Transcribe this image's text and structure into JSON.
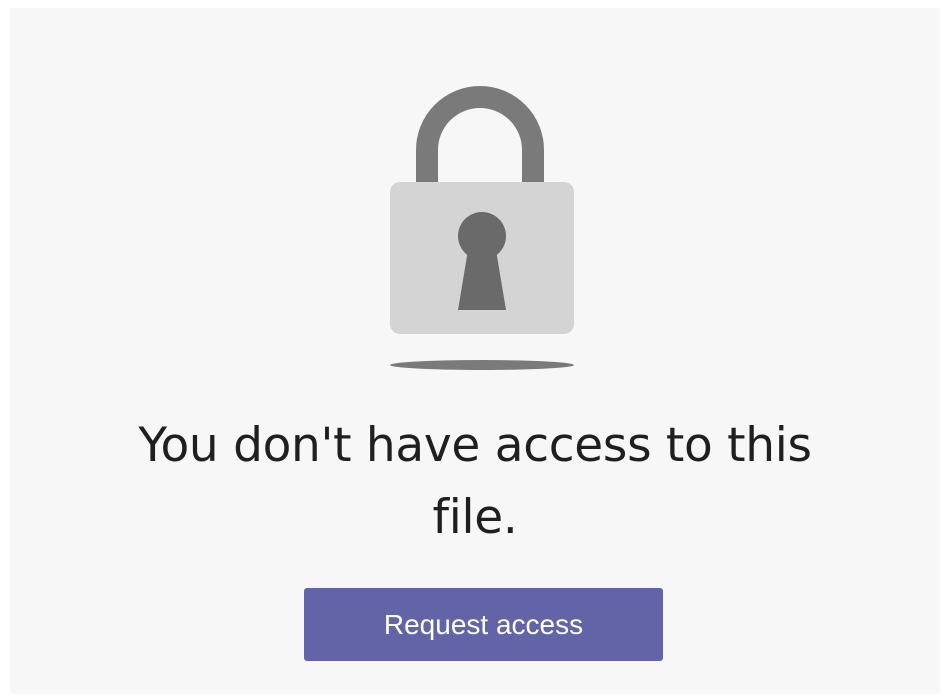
{
  "icons": {
    "main": "lock-icon",
    "shadow": "lock-shadow"
  },
  "message": {
    "line1": "You don't have access to this",
    "line2": "file."
  },
  "actions": {
    "request_access_label": "Request access"
  },
  "colors": {
    "accent": "#6264a7",
    "background": "#f7f7f7",
    "lock_shackle": "#7a7a7a",
    "lock_body": "#d4d4d4",
    "keyhole": "#6a6a6a",
    "text": "#1f1f1f"
  }
}
